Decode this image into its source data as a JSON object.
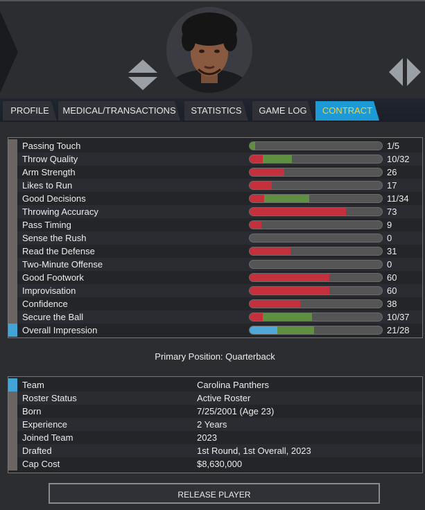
{
  "tabs": [
    {
      "label": "PROFILE"
    },
    {
      "label": "MEDICAL/TRANSACTIONS"
    },
    {
      "label": "STATISTICS"
    },
    {
      "label": "GAME LOG"
    },
    {
      "label": "CONTRACT"
    }
  ],
  "attributes": [
    {
      "label": "Passing Touch",
      "value": "1/5",
      "red": 0,
      "green": 0.04,
      "blue": 0
    },
    {
      "label": "Throw Quality",
      "value": "10/32",
      "red": 0.1,
      "green": 0.22,
      "blue": 0
    },
    {
      "label": "Arm Strength",
      "value": "26",
      "red": 0.26,
      "green": 0,
      "blue": 0
    },
    {
      "label": "Likes to Run",
      "value": "17",
      "red": 0.17,
      "green": 0,
      "blue": 0
    },
    {
      "label": "Good Decisions",
      "value": "11/34",
      "red": 0.11,
      "green": 0.34,
      "blue": 0
    },
    {
      "label": "Throwing Accuracy",
      "value": "73",
      "red": 0.73,
      "green": 0,
      "blue": 0
    },
    {
      "label": "Pass Timing",
      "value": "9",
      "red": 0.09,
      "green": 0,
      "blue": 0
    },
    {
      "label": "Sense the Rush",
      "value": "0",
      "red": 0,
      "green": 0,
      "blue": 0
    },
    {
      "label": "Read the Defense",
      "value": "31",
      "red": 0.31,
      "green": 0,
      "blue": 0
    },
    {
      "label": "Two-Minute Offense",
      "value": "0",
      "red": 0,
      "green": 0,
      "blue": 0
    },
    {
      "label": "Good Footwork",
      "value": "60",
      "red": 0.6,
      "green": 0,
      "blue": 0
    },
    {
      "label": "Improvisation",
      "value": "60",
      "red": 0.6,
      "green": 0,
      "blue": 0
    },
    {
      "label": "Confidence",
      "value": "38",
      "red": 0.38,
      "green": 0,
      "blue": 0
    },
    {
      "label": "Secure the Ball",
      "value": "10/37",
      "red": 0.1,
      "green": 0.37,
      "blue": 0
    },
    {
      "label": "Overall Impression",
      "value": "21/28",
      "red": 0,
      "green": 0.28,
      "blue": 0.21
    }
  ],
  "primary_position": "Primary Position: Quarterback",
  "info": [
    {
      "label": "Team",
      "value": "Carolina Panthers"
    },
    {
      "label": "Roster Status",
      "value": "Active Roster"
    },
    {
      "label": "Born",
      "value": "7/25/2001 (Age 23)"
    },
    {
      "label": "Experience",
      "value": "2 Years"
    },
    {
      "label": "Joined Team",
      "value": "2023"
    },
    {
      "label": "Drafted",
      "value": "1st Round, 1st Overall, 2023"
    },
    {
      "label": "Cap Cost",
      "value": "$8,630,000"
    }
  ],
  "release_label": "RELEASE PLAYER",
  "colors": {
    "accent": "#1d9ad6",
    "active_tab_text": "#f3d23a",
    "bar_red": "#c4303c",
    "bar_green": "#5f9042",
    "bar_blue": "#4ea8d8"
  }
}
